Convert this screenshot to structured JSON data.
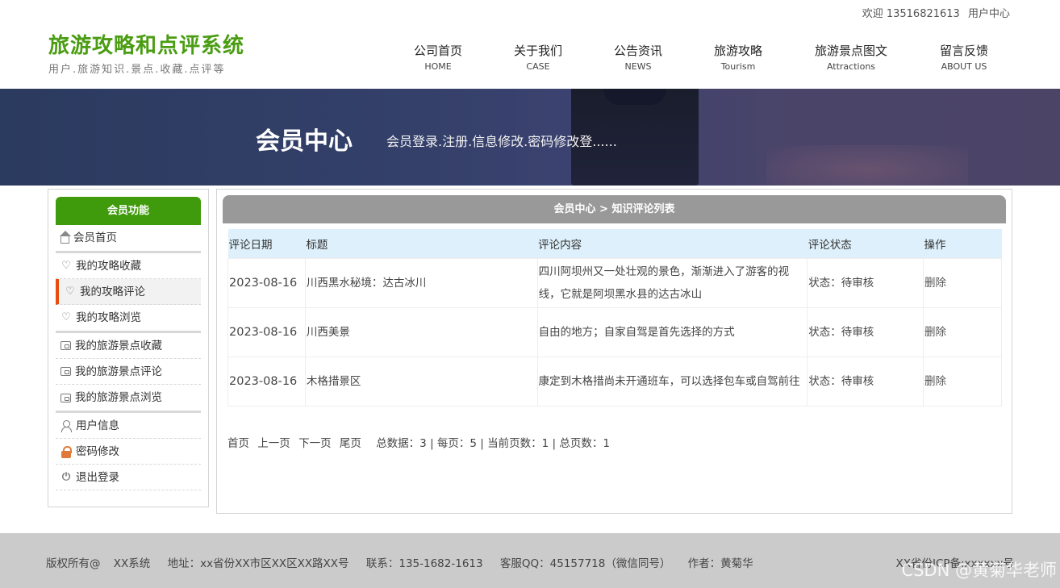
{
  "topbar": {
    "welcome": "欢迎 13516821613",
    "user_center": "用户中心"
  },
  "logo": {
    "title": "旅游攻略和点评系统",
    "subtitle": "用户.旅游知识.景点.收藏.点评等"
  },
  "nav": [
    {
      "cn": "公司首页",
      "en": "HOME"
    },
    {
      "cn": "关于我们",
      "en": "CASE"
    },
    {
      "cn": "公告资讯",
      "en": "NEWS"
    },
    {
      "cn": "旅游攻略",
      "en": "Tourism"
    },
    {
      "cn": "旅游景点图文",
      "en": "Attractions"
    },
    {
      "cn": "留言反馈",
      "en": "ABOUT US"
    }
  ],
  "banner": {
    "title": "会员中心",
    "desc": "会员登录.注册.信息修改.密码修改登......"
  },
  "sidebar": {
    "heading": "会员功能",
    "home": "会员首页",
    "strategy": [
      "我的攻略收藏",
      "我的攻略评论",
      "我的攻略浏览"
    ],
    "scenic": [
      "我的旅游景点收藏",
      "我的旅游景点评论",
      "我的旅游景点浏览"
    ],
    "account": [
      "用户信息",
      "密码修改",
      "退出登录"
    ]
  },
  "main": {
    "breadcrumb": "会员中心 > 知识评论列表",
    "columns": [
      "评论日期",
      "标题",
      "评论内容",
      "评论状态",
      "操作"
    ],
    "rows": [
      {
        "date": "2023-08-16",
        "title": "川西黑水秘境：达古冰川",
        "content": "四川阿坝州又一处壮观的景色，渐渐进入了游客的视线，它就是阿坝黑水县的达古冰山",
        "status": "状态：待审核",
        "action": "删除"
      },
      {
        "date": "2023-08-16",
        "title": "川西美景",
        "content": "自由的地方；自家自驾是首先选择的方式",
        "status": "状态：待审核",
        "action": "删除"
      },
      {
        "date": "2023-08-16",
        "title": "木格措景区",
        "content": "康定到木格措尚未开通班车，可以选择包车或自驾前往",
        "status": "状态：待审核",
        "action": "删除"
      }
    ],
    "pager": {
      "first": "首页",
      "prev": "上一页",
      "next": "下一页",
      "last": "尾页",
      "stats": "总数据：3 | 每页：5 | 当前页数：1 | 总页数：1"
    }
  },
  "footer": {
    "copyright": "版权所有@",
    "system": "XX系统",
    "address": "地址：xx省份XX市区XX区XX路XX号",
    "contact": "联系：135-1682-1613",
    "qq": "客服QQ：45157718（微信同号）",
    "author": "作者：黄菊华",
    "icp": "XX省份ICP备:xxxxxx号",
    "watermark": "CSDN @黄菊华老师"
  }
}
